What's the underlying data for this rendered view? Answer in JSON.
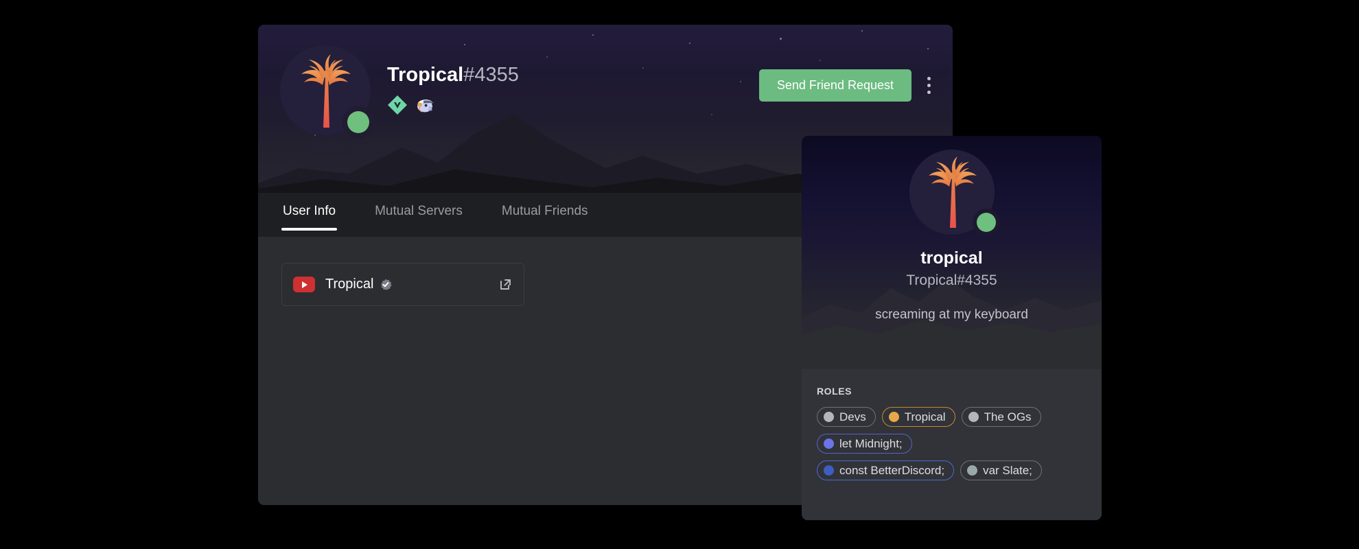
{
  "theme": {
    "page_background": "#000000",
    "modal_background": "#2b2d31",
    "tabbar_background": "#1e1f22",
    "roles_background": "#313338",
    "accent_green": "#6cbb81",
    "status_online": "#6fbf7e",
    "text_primary": "#ffffff",
    "text_muted": "#b6b8c0",
    "youtube_red": "#cd3131"
  },
  "profile_modal": {
    "avatar": {
      "icon": "palm-tree-avatar",
      "status": "online"
    },
    "header": {
      "username": "Tropical",
      "discriminator": "#4355",
      "badges": [
        {
          "icon": "betterdiscord-badge",
          "label": "BetterDiscord"
        },
        {
          "icon": "discord-nitro-helmet-badge",
          "label": "Discord Badge"
        }
      ]
    },
    "actions": {
      "friend_request_label": "Send Friend Request",
      "more_icon": "kebab-menu-icon"
    },
    "tabs": [
      {
        "label": "User Info",
        "active": true
      },
      {
        "label": "Mutual Servers",
        "active": false
      },
      {
        "label": "Mutual Friends",
        "active": false
      }
    ],
    "connections": [
      {
        "service_icon": "youtube-icon",
        "name": "Tropical",
        "verified": true,
        "verified_icon": "verified-check-icon",
        "open_icon": "external-link-icon"
      }
    ]
  },
  "popout_card": {
    "avatar": {
      "icon": "palm-tree-avatar",
      "status": "online"
    },
    "display_name": "tropical",
    "tag": "Tropical#4355",
    "custom_status": "screaming at my keyboard",
    "roles_heading": "ROLES",
    "roles": [
      [
        {
          "label": "Devs",
          "dot_color": "#b4b6bb",
          "border_color": "#707176"
        },
        {
          "label": "Tropical",
          "dot_color": "#e8a849",
          "border_color": "#c28a33"
        },
        {
          "label": "The OGs",
          "dot_color": "#b4b6bb",
          "border_color": "#707176"
        }
      ],
      [
        {
          "label": "let Midnight;",
          "dot_color": "#6c75e8",
          "border_color": "#5961cf"
        }
      ],
      [
        {
          "label": "const BetterDiscord;",
          "dot_color": "#3d5dc4",
          "border_color": "#4b6ad4"
        },
        {
          "label": "var Slate;",
          "dot_color": "#9aa9a7",
          "border_color": "#707176"
        }
      ]
    ]
  }
}
